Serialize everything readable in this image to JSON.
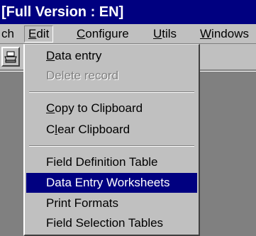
{
  "window": {
    "title": "[Full Version : EN]"
  },
  "menubar": {
    "items": [
      {
        "label": "ch"
      },
      {
        "label": "Edit",
        "mnemonic": "E",
        "rest": "dit"
      },
      {
        "label": "Configure",
        "mnemonic": "C",
        "rest": "onfigure"
      },
      {
        "label": "Utils",
        "mnemonic": "U",
        "rest": "tils"
      },
      {
        "label": "Windows",
        "mnemonic": "W",
        "rest": "indows"
      }
    ]
  },
  "toolbar": {
    "icon": "printer-icon"
  },
  "edit_menu": {
    "data_entry": {
      "mnemonic": "D",
      "rest": "ata entry"
    },
    "delete_record": {
      "label": "Delete record",
      "disabled": true
    },
    "copy_clipboard": {
      "mnemonic": "C",
      "rest": "opy to Clipboard"
    },
    "clear_clipboard": {
      "pre": "C",
      "mnemonic": "l",
      "rest": "ear Clipboard"
    },
    "field_definition": {
      "label": "Field Definition Table"
    },
    "data_entry_worksheets": {
      "label": "Data Entry Worksheets",
      "highlighted": true
    },
    "print_formats": {
      "label": "Print Formats"
    },
    "field_selection": {
      "label": "Field Selection Tables"
    }
  },
  "colors": {
    "title_bg": "#000080",
    "highlight_bg": "#000080",
    "menu_bg": "#c0c0c0",
    "workspace_bg": "#808080"
  }
}
